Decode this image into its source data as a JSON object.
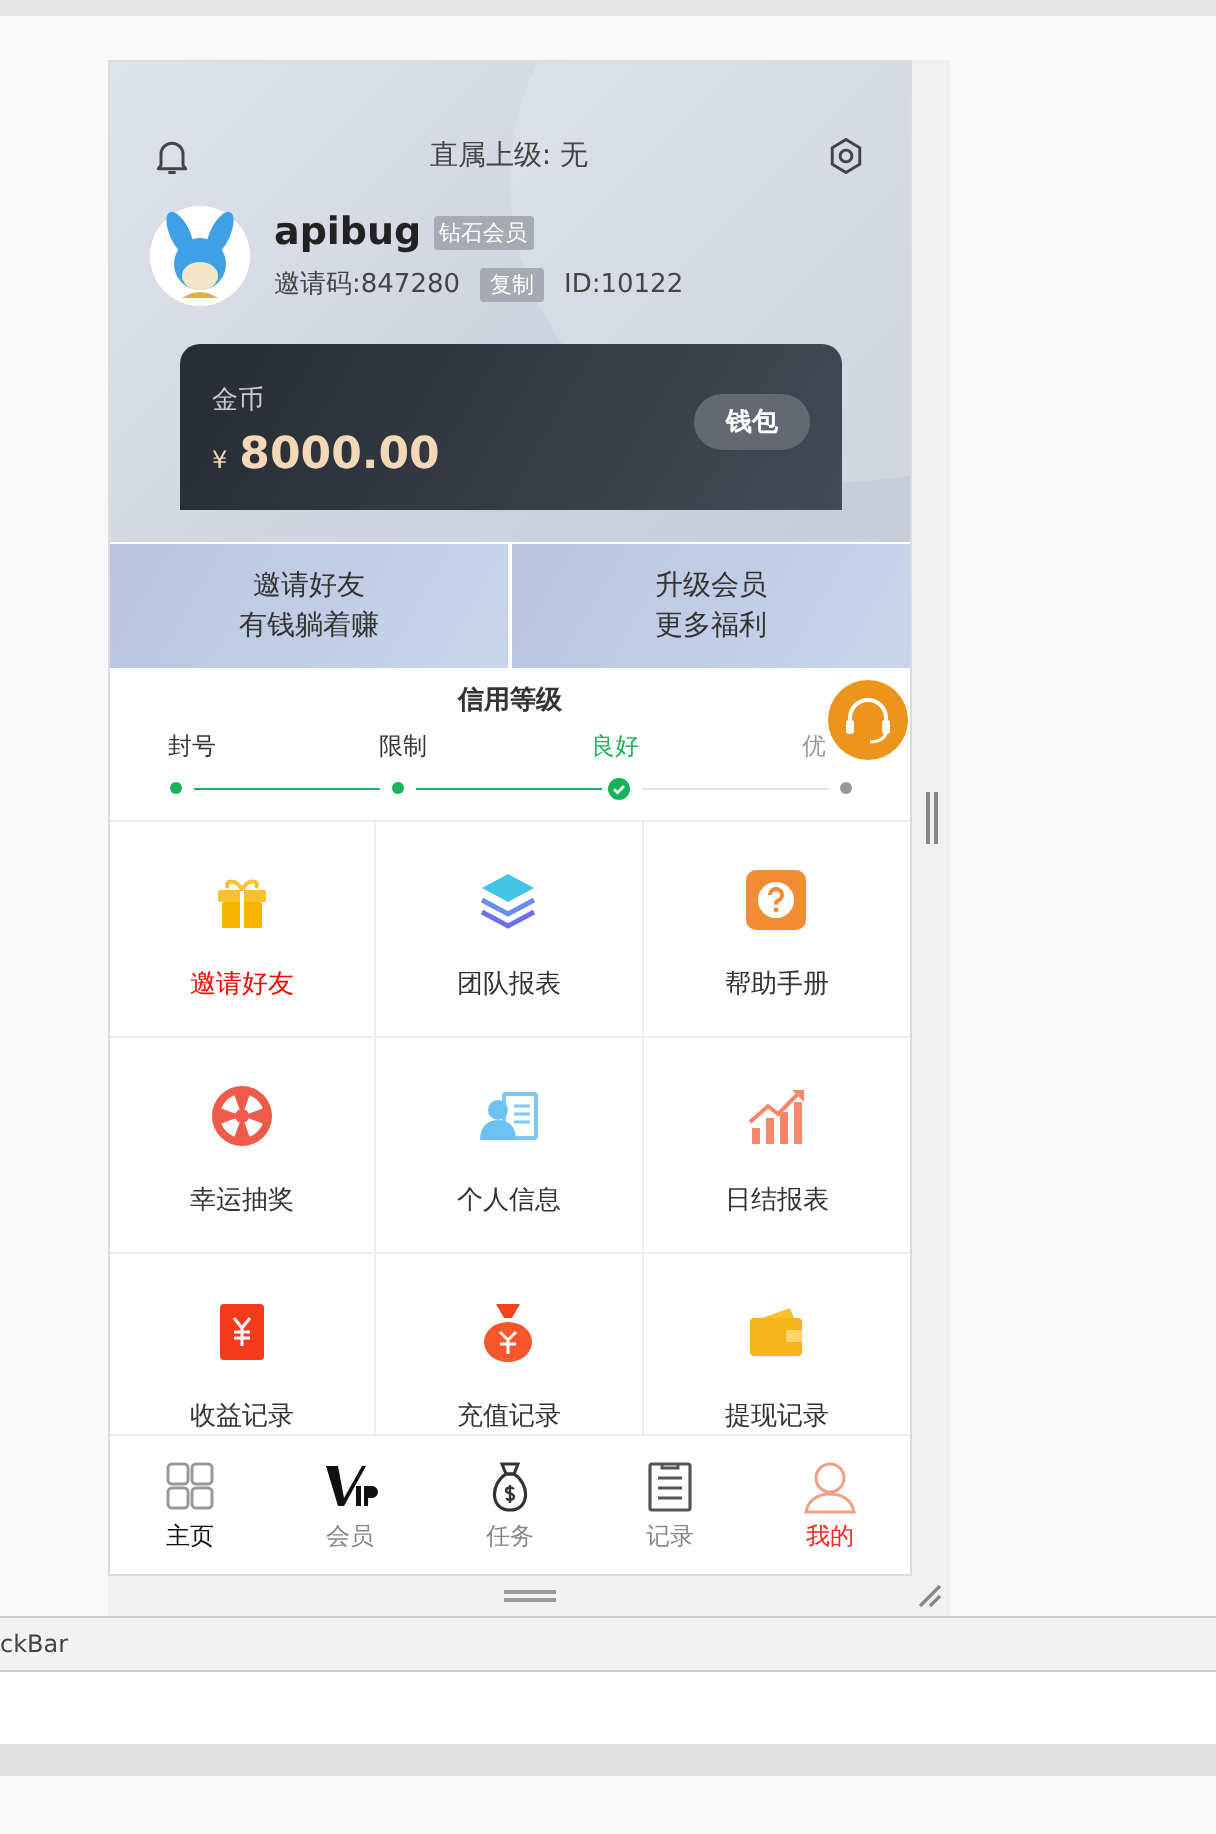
{
  "header": {
    "title": "直属上级: 无"
  },
  "profile": {
    "name": "apibug",
    "level_badge": "钻石会员",
    "invite_code": "邀请码:847280",
    "copy_button": "复制",
    "user_id": "ID:10122"
  },
  "wallet": {
    "label": "金币",
    "currency": "¥",
    "amount": "8000.00",
    "button": "钱包"
  },
  "promos": [
    {
      "line1": "邀请好友",
      "line2": "有钱躺着赚"
    },
    {
      "line1": "升级会员",
      "line2": "更多福利"
    }
  ],
  "credit": {
    "title": "信用等级",
    "steps": [
      {
        "label": "封号",
        "reached": true,
        "selected": false
      },
      {
        "label": "限制",
        "reached": true,
        "selected": false
      },
      {
        "label": "良好",
        "reached": true,
        "selected": true
      },
      {
        "label": "优",
        "reached": false,
        "selected": false
      }
    ]
  },
  "menu": [
    {
      "label": "邀请好友",
      "highlighted": true
    },
    {
      "label": "团队报表",
      "highlighted": false
    },
    {
      "label": "帮助手册",
      "highlighted": false
    },
    {
      "label": "幸运抽奖",
      "highlighted": false
    },
    {
      "label": "个人信息",
      "highlighted": false
    },
    {
      "label": "日结报表",
      "highlighted": false
    },
    {
      "label": "收益记录",
      "highlighted": false
    },
    {
      "label": "充值记录",
      "highlighted": false
    },
    {
      "label": "提现记录",
      "highlighted": false
    }
  ],
  "tabs": [
    {
      "label": "主页",
      "selected": false,
      "highlighted": true
    },
    {
      "label": "会员",
      "selected": false,
      "highlighted": false
    },
    {
      "label": "任务",
      "selected": false,
      "highlighted": false
    },
    {
      "label": "记录",
      "selected": false,
      "highlighted": false
    },
    {
      "label": "我的",
      "selected": true,
      "highlighted": false
    }
  ],
  "status_bar": {
    "text": "ckBar"
  }
}
